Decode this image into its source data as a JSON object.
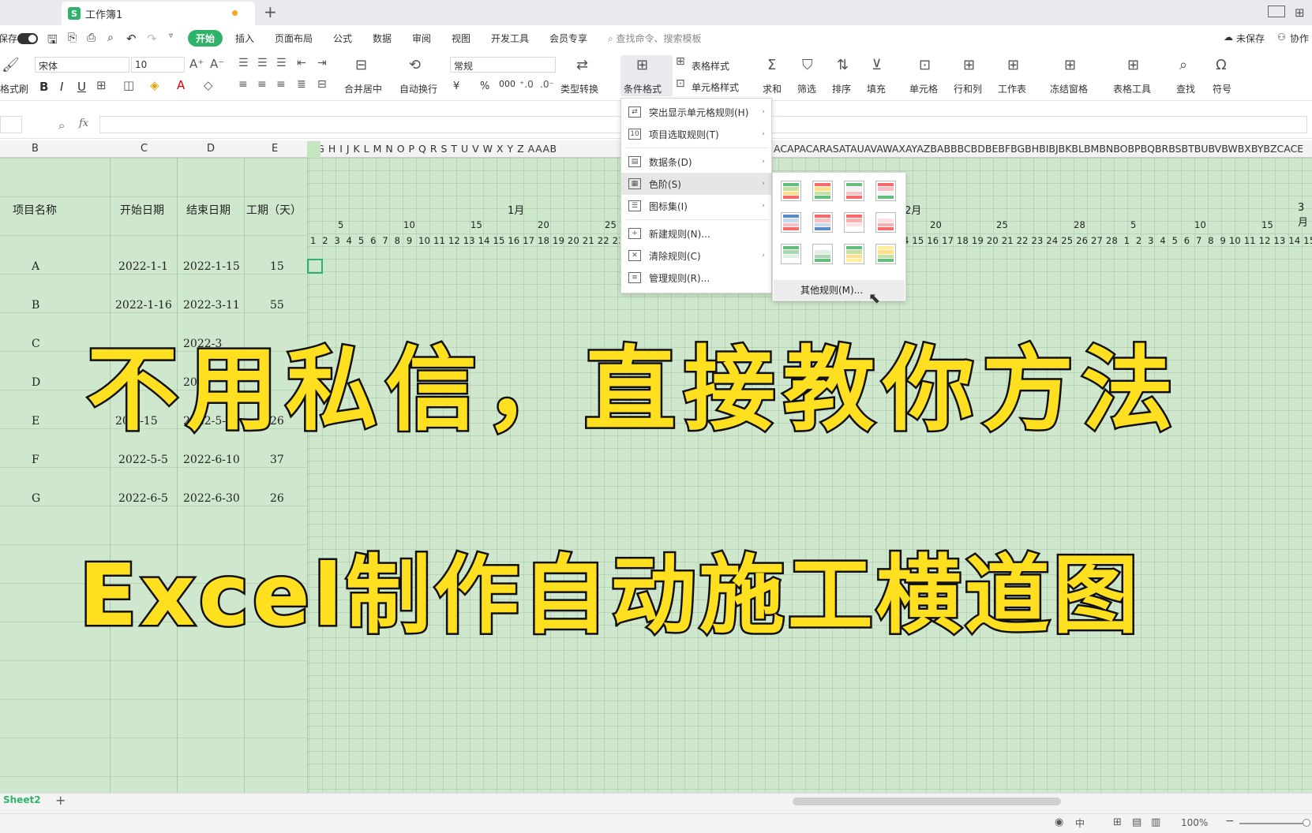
{
  "tabs": {
    "partial_left": "",
    "active": "工作簿1",
    "logo": "S"
  },
  "menu": {
    "save_label": "保存",
    "items": [
      "开始",
      "插入",
      "页面布局",
      "公式",
      "数据",
      "审阅",
      "视图",
      "开发工具",
      "会员专享"
    ],
    "search_placeholder": "查找命令、搜索模板",
    "unsaved": "未保存",
    "collab": "协作"
  },
  "ribbon": {
    "format_painter": "格式刷",
    "font_name": "宋体",
    "font_size": "10",
    "merge": "合并居中",
    "wrap": "自动换行",
    "number_format": "常规",
    "type_convert": "类型转换",
    "cond_format": "条件格式",
    "table_style": "表格样式",
    "cell_style": "单元格样式",
    "sum": "求和",
    "filter": "筛选",
    "sort": "排序",
    "fill": "填充",
    "cell": "单元格",
    "rowcol": "行和列",
    "worksheet": "工作表",
    "freeze": "冻结窗格",
    "table_tools": "表格工具",
    "find": "查找",
    "symbol": "符号",
    "bold": "B",
    "italic": "I",
    "underline": "U",
    "currency": "¥",
    "percent": "%",
    "thousands": "000"
  },
  "formula_bar": {
    "fx": "fx"
  },
  "columns": {
    "wide": [
      "B",
      "C",
      "D",
      "E"
    ],
    "narrow_left": "F G H I J K L M N O P Q R S T U V W X Y Z AAAB",
    "narrow_right": "ACAPACARASATAUAVAWAXAYAZBABBBCBDBEBFBGBHBIBJBKBLBMBNBOBPBQBRBSBTBUBVBWBXBYBZCACE"
  },
  "table": {
    "headers": [
      "项目名称",
      "开始日期",
      "结束日期",
      "工期（天）"
    ],
    "rows": [
      {
        "name": "A",
        "start": "2022-1-1",
        "end": "2022-1-15",
        "days": "15"
      },
      {
        "name": "B",
        "start": "2022-1-16",
        "end": "2022-3-11",
        "days": "55"
      },
      {
        "name": "C",
        "start": "2022-3",
        "end": "",
        "days": ""
      },
      {
        "name": "D",
        "start": "",
        "end": "2022",
        "days": ""
      },
      {
        "name": "E",
        "start": "20  4-15",
        "end": "2022-5-10",
        "days": "26"
      },
      {
        "name": "F",
        "start": "2022-5-5",
        "end": "2022-6-10",
        "days": "37"
      },
      {
        "name": "G",
        "start": "2022-6-5",
        "end": "2022-6-30",
        "days": "26"
      }
    ]
  },
  "gantt": {
    "month1": "1月",
    "month2": "2月",
    "month3": "3月",
    "weeks_left": [
      "5",
      "10",
      "15",
      "20",
      "25"
    ],
    "weeks_right": [
      "20",
      "25",
      "28",
      "5",
      "10",
      "15"
    ],
    "days_left": "1  2  3  4  5  6  7  8  9  10 11 12 13 14 15 16 17 18 19 20 21 22 23 2",
    "days_right": "4 15 16 17 18 19 20 21 22 23 24 25 26 27 28  1  2  3  4  5  6  7  8  9 10 11 12 13 14 15 16"
  },
  "cond_menu": {
    "items": [
      {
        "label": "突出显示单元格规则(H)",
        "arrow": "›"
      },
      {
        "label": "项目选取规则(T)",
        "arrow": "›"
      },
      {
        "label": "数据条(D)",
        "arrow": "›"
      },
      {
        "label": "色阶(S)",
        "arrow": "›"
      },
      {
        "label": "图标集(I)",
        "arrow": "›"
      },
      {
        "label": "新建规则(N)...",
        "arrow": ""
      },
      {
        "label": "清除规则(C)",
        "arrow": "›"
      },
      {
        "label": "管理规则(R)...",
        "arrow": ""
      }
    ],
    "other_rules": "其他规则(M)..."
  },
  "overlay": {
    "line1": "不用私信，直接教你方法",
    "line2": "Excel制作自动施工横道图"
  },
  "bottom": {
    "sheet_tab": "Sheet2",
    "add": "+",
    "zoom": "100%",
    "ime": "中"
  },
  "colors": {
    "accent": "#2fb36b",
    "sheet_bg": "#cfe8cd",
    "overlay_fill": "#ffe021"
  }
}
